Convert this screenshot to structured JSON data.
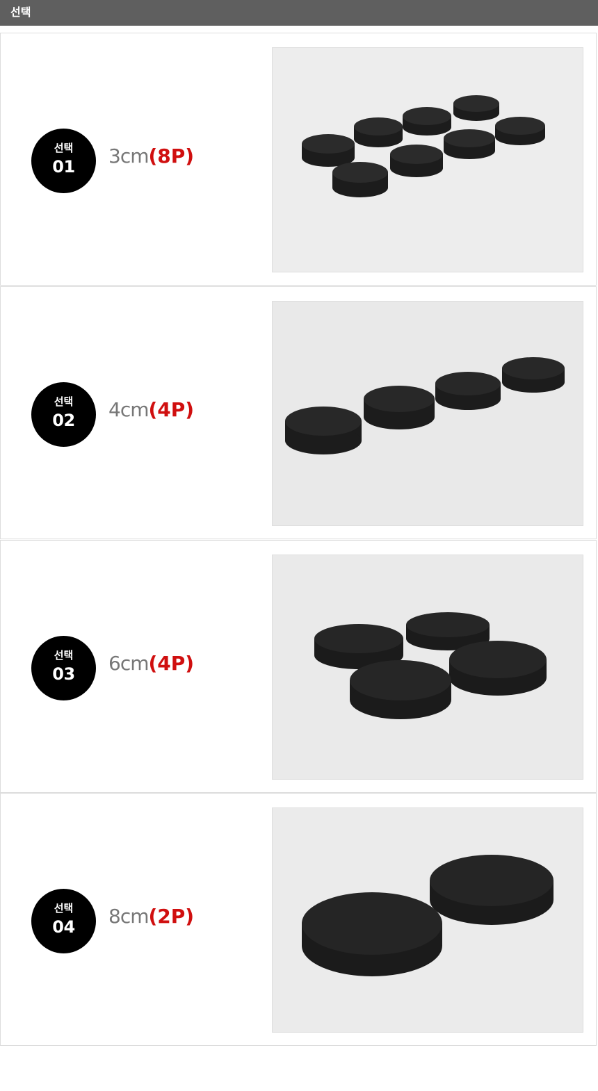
{
  "header": {
    "title": "선택"
  },
  "options": [
    {
      "word": "선택",
      "number": "01",
      "size": "3cm",
      "quantity": "(8P)",
      "photo_icon": "foam-disc-photo"
    },
    {
      "word": "선택",
      "number": "02",
      "size": "4cm",
      "quantity": "(4P)",
      "photo_icon": "foam-disc-photo"
    },
    {
      "word": "선택",
      "number": "03",
      "size": "6cm",
      "quantity": "(4P)",
      "photo_icon": "foam-disc-photo"
    },
    {
      "word": "선택",
      "number": "04",
      "size": "8cm",
      "quantity": "(2P)",
      "photo_icon": "foam-disc-photo"
    }
  ],
  "colors": {
    "header_bg": "#5f5f5f",
    "badge_bg": "#000000",
    "size_text": "#777777",
    "quantity_text": "#d00f0f",
    "row_border": "#dcdcdc",
    "photo_bg": "#ececec",
    "foam": "#1f1f1f"
  }
}
